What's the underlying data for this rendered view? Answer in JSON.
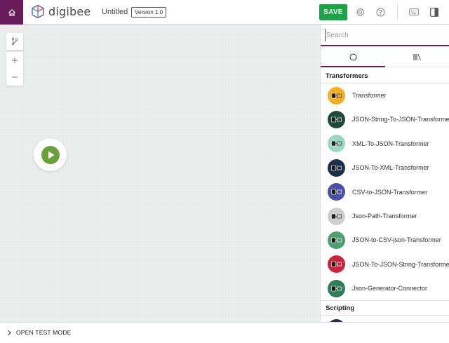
{
  "header": {
    "logo_text": "digibee",
    "title": "Untitled",
    "version": "Version 1.0",
    "save_label": "SAVE"
  },
  "colors": {
    "brand": "#6a1b5c",
    "save": "#1da345",
    "start": "#6aa03a"
  },
  "search": {
    "placeholder": "Search",
    "value": ""
  },
  "tabs": [
    {
      "icon": "circle-icon",
      "active": true
    },
    {
      "icon": "library-icon",
      "active": false
    }
  ],
  "sections": {
    "transformers": "Transformers",
    "scripting": "Scripting"
  },
  "items": [
    {
      "label": "Transformer",
      "icon": "transformer-icon",
      "color": "#f2b01e"
    },
    {
      "label": "JSON-String-To-JSON-Transformer",
      "icon": "json-string-to-json-icon",
      "color": "#1f4a3a"
    },
    {
      "label": "XML-To-JSON-Transformer",
      "icon": "xml-to-json-icon",
      "color": "#9bd7c2"
    },
    {
      "label": "JSON-To-XML-Transformer",
      "icon": "json-to-xml-icon",
      "color": "#1e2f4a"
    },
    {
      "label": "CSV-to-JSON-Transformer",
      "icon": "csv-to-json-icon",
      "color": "#4b4fa8"
    },
    {
      "label": "Json-Path-Transformer",
      "icon": "json-path-icon",
      "color": "#cfcfcf"
    },
    {
      "label": "JSON-to-CSV-json-Transformer",
      "icon": "json-to-csv-icon",
      "color": "#4f9e6e"
    },
    {
      "label": "JSON-To-JSON-String-Transformer",
      "icon": "json-to-json-string-icon",
      "color": "#c9253d"
    },
    {
      "label": "Json-Generator-Connector",
      "icon": "json-generator-icon",
      "color": "#2e7d5b"
    }
  ],
  "footer": {
    "test_mode_label": "OPEN TEST MODE"
  }
}
